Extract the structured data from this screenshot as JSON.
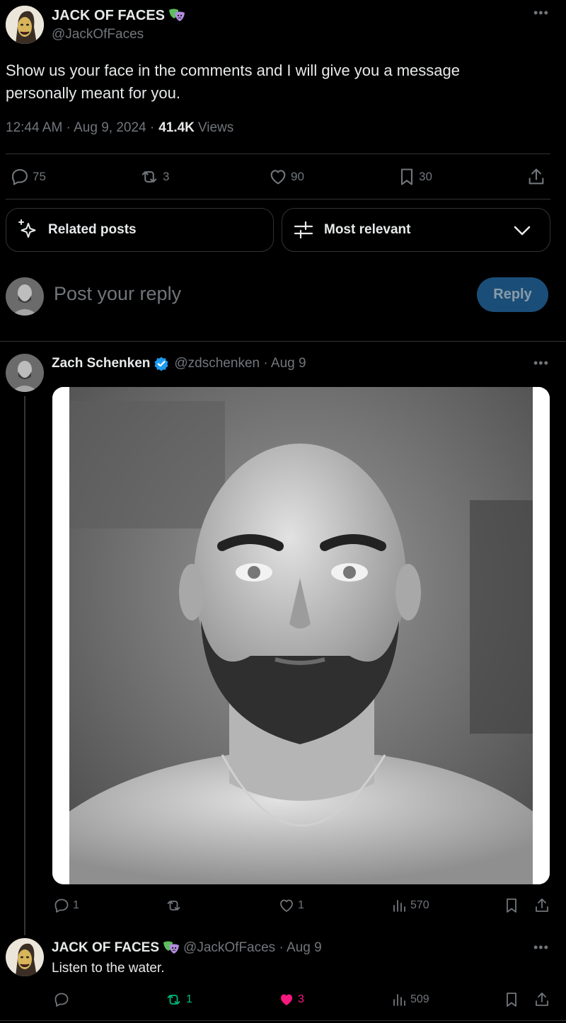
{
  "main_post": {
    "author_name": "JACK OF FACES",
    "handle": "@JackOfFaces",
    "text_line1": "Show us your face in the comments and I will give you a message",
    "text_line2": "personally meant for you.",
    "time": "12:44 AM · Aug 9, 2024 ·",
    "views_count": "41.4K",
    "views_label": "Views",
    "replies": "75",
    "reposts": "3",
    "likes": "90",
    "bookmarks": "30"
  },
  "filters": {
    "related_label": "Related posts",
    "sort_label": "Most relevant"
  },
  "composer": {
    "placeholder": "Post your reply",
    "reply_button": "Reply"
  },
  "reply1": {
    "author_name": "Zach Schenken",
    "handle_date": "@zdschenken · Aug 9",
    "replies": "1",
    "likes": "1",
    "views": "570"
  },
  "reply2": {
    "author_name": "JACK OF FACES",
    "handle_date": "@JackOfFaces · Aug 9",
    "text": "Listen to the water.",
    "reposts": "1",
    "likes": "3",
    "views": "509"
  },
  "colors": {
    "background": "#000000",
    "text": "#e7e9ea",
    "muted": "#71767b",
    "verified": "#1d9bf0",
    "reply_button": "#1a4e78",
    "repost_active": "#00ba7c",
    "like_active": "#f91880"
  },
  "icons": [
    "theater-masks-icon",
    "verified-badge-icon",
    "more-icon",
    "reply-icon",
    "repost-icon",
    "like-icon",
    "bookmark-icon",
    "share-icon",
    "sparkle-icon",
    "sliders-icon",
    "chevron-down-icon",
    "views-icon"
  ]
}
